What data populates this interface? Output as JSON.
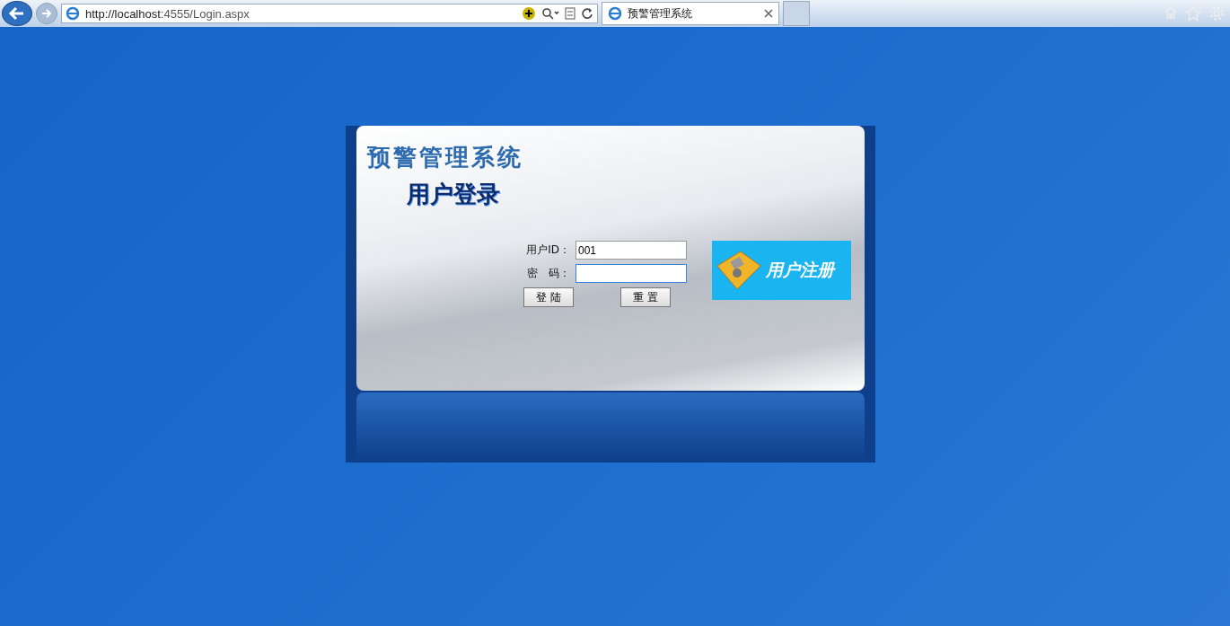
{
  "browser": {
    "url_host": "http://localhost",
    "url_rest": ":4555/Login.aspx",
    "tabs": [
      {
        "title": "预警管理系统",
        "selected": true
      }
    ]
  },
  "login": {
    "title": "预警管理系统",
    "banner": "用户登录",
    "fields": [
      {
        "label": "用户ID：",
        "value": "001",
        "focused": false
      },
      {
        "label": "密　码：",
        "focused": true
      }
    ],
    "buttons": [
      "登 陆",
      "重 置"
    ],
    "register": "用户注册"
  }
}
